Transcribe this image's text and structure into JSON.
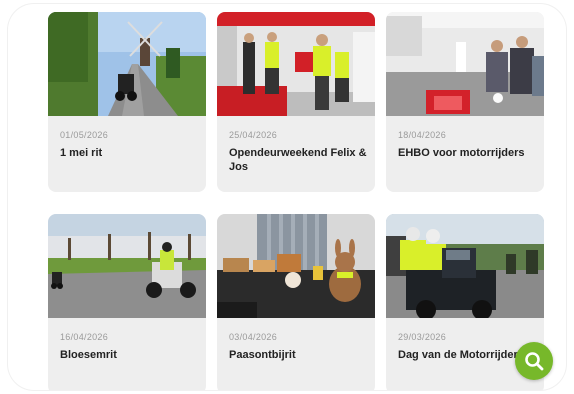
{
  "posts": [
    {
      "date": "01/05/2026",
      "title": "1 mei rit"
    },
    {
      "date": "25/04/2026",
      "title": "Opendeurweekend Felix & Jos"
    },
    {
      "date": "18/04/2026",
      "title": "EHBO voor motorrijders"
    },
    {
      "date": "16/04/2026",
      "title": "Bloesemrit"
    },
    {
      "date": "03/04/2026",
      "title": "Paasontbijrit"
    },
    {
      "date": "29/03/2026",
      "title": "Dag van de Motorrijder"
    }
  ],
  "colors": {
    "accent": "#77b82a",
    "card_bg": "#eeeeee",
    "date": "#9a9a9a",
    "title": "#222222"
  },
  "icons": {
    "fab": "search-icon"
  }
}
